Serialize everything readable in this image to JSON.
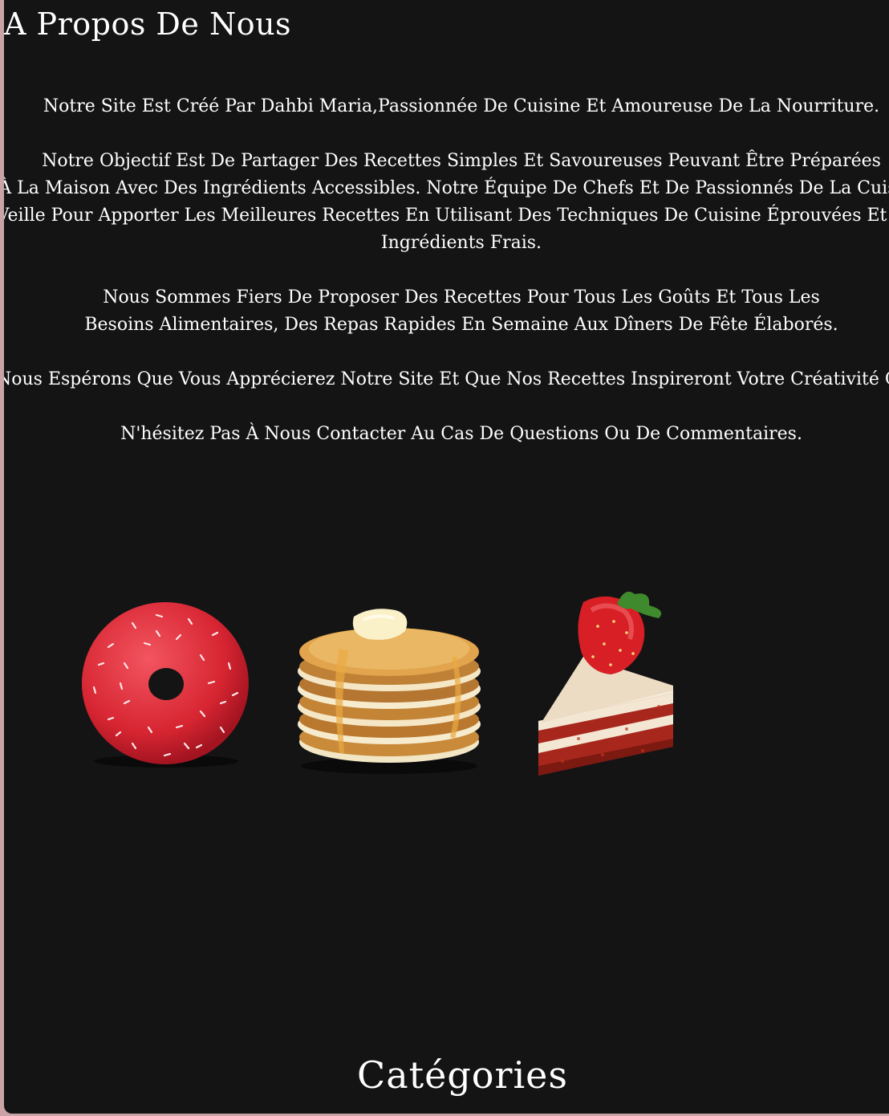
{
  "about": {
    "title": "A Propos De Nous",
    "lines": [
      "Notre Site Est Créé Par Dahbi Maria,Passionnée De Cuisine Et Amoureuse De La Nourriture.",
      "Notre Objectif Est De Partager Des Recettes Simples Et Savoureuses Peuvant Être Préparées",
      "À La Maison Avec Des Ingrédients Accessibles. Notre Équipe De Chefs Et De Passionnés De La Cuisine",
      "Veille Pour Apporter Les Meilleures Recettes En Utilisant Des Techniques De Cuisine Éprouvées Et Des",
      "Ingrédients Frais.",
      "Nous Sommes Fiers De Proposer Des Recettes Pour Tous Les Goûts Et Tous Les",
      "Besoins Alimentaires, Des Repas Rapides En Semaine Aux Dîners De Fête Élaborés.",
      "Nous Espérons Que Vous Apprécierez Notre Site Et Que Nos Recettes Inspireront Votre Créativité Culinaire.",
      "N'hésitez Pas À Nous Contacter Au Cas De Questions Ou De Commentaires."
    ]
  },
  "gallery": {
    "images": [
      "donut-image",
      "pancakes-image",
      "red-velvet-cake-image"
    ]
  },
  "categories": {
    "title": "Catégories"
  },
  "colors": {
    "background": "#141415",
    "frame": "#c9a3a6",
    "text": "#ffffff"
  }
}
